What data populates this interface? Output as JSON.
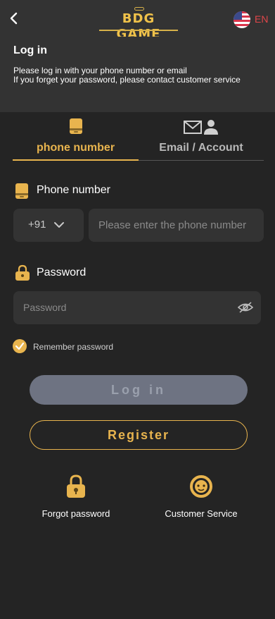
{
  "topbar": {
    "back_icon": "chevron-left-icon",
    "logo_text": "BDG GAME",
    "language": "EN",
    "flag_icon": "us-flag-icon"
  },
  "header": {
    "title": "Log in",
    "subtitle_line1": "Please log in with your phone number or email",
    "subtitle_line2": "If you forget your password, please contact customer service"
  },
  "tabs": [
    {
      "label": "phone number",
      "icon": "phone-icon",
      "active": true
    },
    {
      "label": "Email / Account",
      "icon": "mail-user-icon",
      "active": false
    }
  ],
  "phone": {
    "label": "Phone number",
    "country_code": "+91",
    "placeholder": "Please enter the phone number"
  },
  "password": {
    "label": "Password",
    "placeholder": "Password"
  },
  "remember": {
    "label": "Remember password",
    "checked": true
  },
  "buttons": {
    "login": "Log in",
    "register": "Register"
  },
  "footer": {
    "forgot": "Forgot password",
    "service": "Customer Service"
  },
  "colors": {
    "accent": "#e8b44e",
    "background": "#242424",
    "panel": "#333333",
    "login_disabled": "#6e7382"
  }
}
